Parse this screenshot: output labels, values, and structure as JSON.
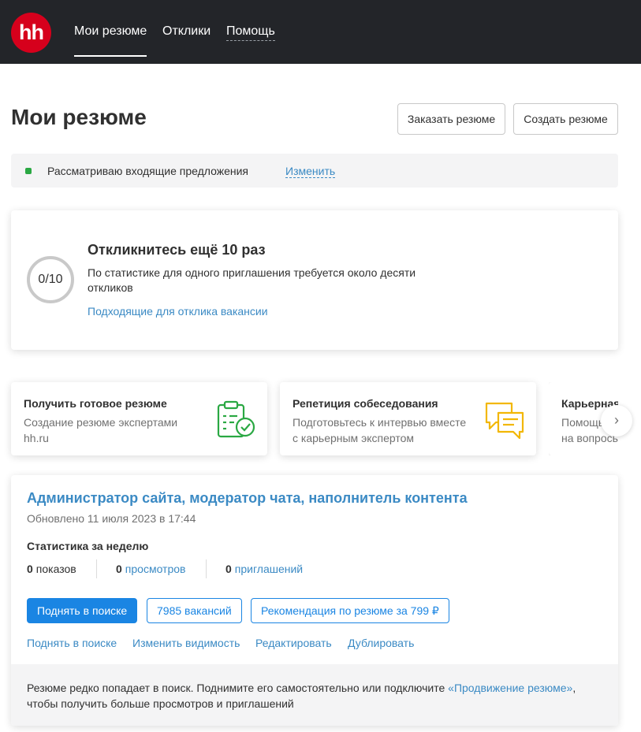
{
  "header": {
    "logo_text": "hh",
    "nav": [
      {
        "label": "Мои резюме"
      },
      {
        "label": "Отклики"
      },
      {
        "label": "Помощь"
      }
    ]
  },
  "page": {
    "title": "Мои резюме",
    "order_button": "Заказать резюме",
    "create_button": "Создать резюме"
  },
  "status": {
    "text": "Рассматриваю входящие предложения",
    "change_link": "Изменить",
    "dot_color": "#2aa843"
  },
  "goal": {
    "progress_label": "0/10",
    "progress": {
      "current": 0,
      "total": 10
    },
    "title": "Откликнитесь ещё 10 раз",
    "text": "По статистике для одного приглашения требуется около десяти откликов",
    "link": "Подходящие для отклика вакансии"
  },
  "promos": [
    {
      "title": "Получить готовое резюме",
      "text": "Создание резюме экспертами\nhh.ru",
      "icon": "clipboard-check-icon"
    },
    {
      "title": "Репетиция собеседования",
      "text": "Подготовьтесь к интервью вместе\nс карьерным экспертом",
      "icon": "chat-bubbles-icon"
    },
    {
      "title": "Карьерная",
      "text": "Помощь\nна вопрось",
      "icon": ""
    }
  ],
  "resume": {
    "title": "Администратор сайта, модератор чата, наполнитель контента",
    "updated": "Обновлено 11 июля 2023 в 17:44",
    "stats_heading": "Статистика за неделю",
    "stats": [
      {
        "value": "0",
        "label": "показов"
      },
      {
        "value": "0",
        "label": "просмотров"
      },
      {
        "value": "0",
        "label": "приглашений"
      }
    ],
    "raise_button": "Поднять в поиске",
    "vacancies_button": "7985 вакансий",
    "recommendation_button": "Рекомендация по резюме за 799 ₽",
    "links": [
      "Поднять в поиске",
      "Изменить видимость",
      "Редактировать",
      "Дублировать"
    ],
    "notice_text": "Резюме редко попадает в поиск. Поднимите его самостоятельно или подключите ",
    "notice_link": "«Продвижение резюме»",
    "notice_tail": ", чтобы получить больше просмотров и приглашений"
  },
  "colors": {
    "header_bg": "#232529",
    "logo_red": "#d6001c",
    "link_blue": "#3b8ac4",
    "primary_blue": "#1a85e3"
  }
}
